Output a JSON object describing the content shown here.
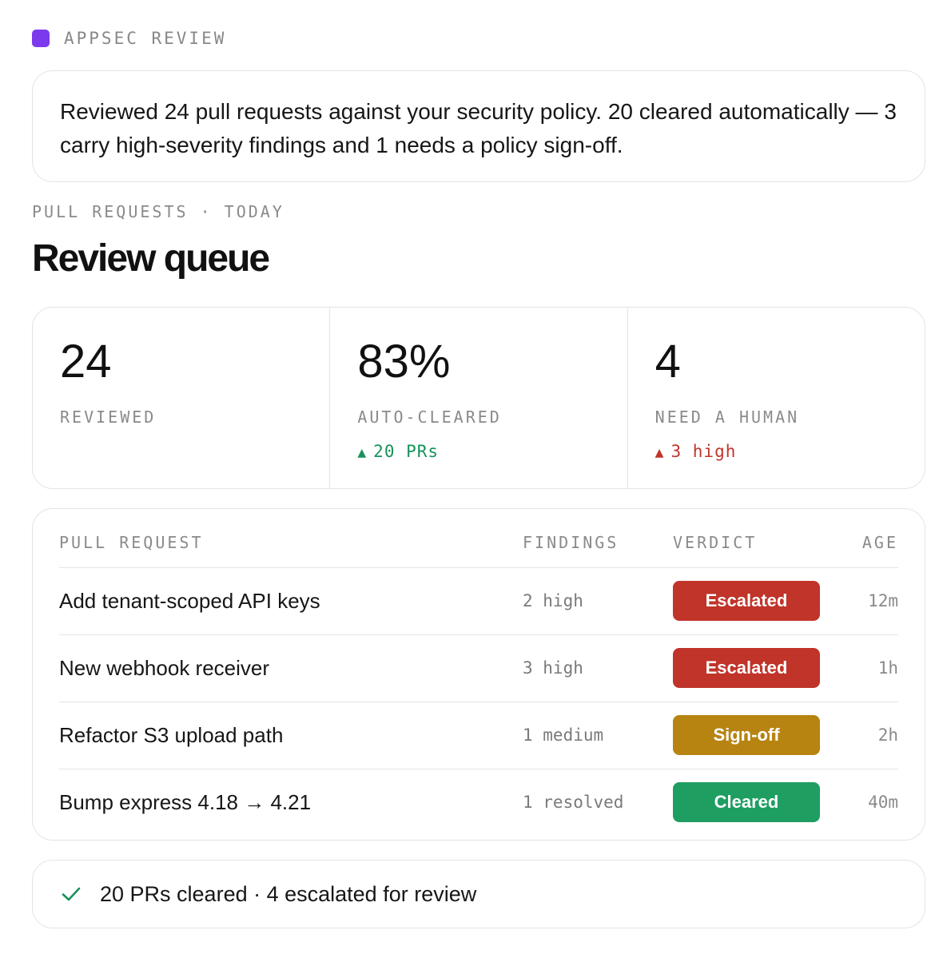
{
  "app": {
    "title": "APPSEC REVIEW",
    "accent": "#7c3aed"
  },
  "summary": {
    "text": "Reviewed 24 pull requests against your security policy. 20 cleared automatically — 3 carry high-severity findings and 1 needs a policy sign-off."
  },
  "section": {
    "label": "PULL REQUESTS · TODAY",
    "title": "Review queue"
  },
  "stats": [
    {
      "value": "24",
      "label": "REVIEWED",
      "delta": ""
    },
    {
      "value": "83%",
      "label": "AUTO-CLEARED",
      "delta": "20 PRs",
      "delta_color": "#17935b"
    },
    {
      "value": "4",
      "label": "NEED A HUMAN",
      "delta": "3 high",
      "delta_color": "#c0342a"
    }
  ],
  "table": {
    "headers": {
      "pr": "PULL REQUEST",
      "findings": "FINDINGS",
      "verdict": "VERDICT",
      "age": "AGE"
    },
    "rows": [
      {
        "title": "Add tenant-scoped API keys",
        "findings": "2 high",
        "verdict": "Escalated",
        "verdict_color": "#c0342a",
        "age": "12m"
      },
      {
        "title": "New webhook receiver",
        "findings": "3 high",
        "verdict": "Escalated",
        "verdict_color": "#c0342a",
        "age": "1h"
      },
      {
        "title": "Refactor S3 upload path",
        "findings": "1 medium",
        "verdict": "Sign-off",
        "verdict_color": "#b78412",
        "age": "2h"
      },
      {
        "title": "Bump express 4.18 → 4.21",
        "findings": "1 resolved",
        "verdict": "Cleared",
        "verdict_color": "#1f9e62",
        "age": "40m"
      }
    ]
  },
  "footer": {
    "icon": "check-icon",
    "text": "20 PRs cleared · 4 escalated for review"
  }
}
